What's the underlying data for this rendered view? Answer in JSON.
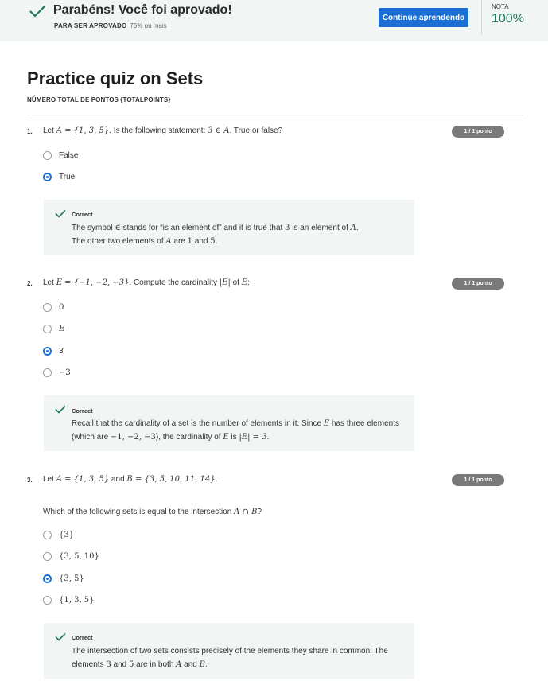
{
  "banner": {
    "congrats": "Parabéns! Você foi aprovado!",
    "pass_label": "PARA SER APROVADO",
    "pass_value": "75% ou mais",
    "continue_label": "Continue aprendendo",
    "grade_label": "NOTA",
    "grade_value": "100%",
    "accent_color": "#1f7a55",
    "button_color": "#1a6fd6"
  },
  "quiz": {
    "title": "Practice quiz on Sets",
    "subtitle": "NÚMERO TOTAL DE PONTOS {TOTALPOINTS}",
    "questions": [
      {
        "number": "1.",
        "score": "1 / 1 ponto",
        "options": [
          "False",
          "True"
        ],
        "selected": "True",
        "feedback_title": "Correct"
      },
      {
        "number": "2.",
        "score": "1 / 1 ponto",
        "options": [
          "0",
          "E",
          "3",
          "−3"
        ],
        "selected": "3",
        "feedback_title": "Correct"
      },
      {
        "number": "3.",
        "score": "1 / 1 ponto",
        "options": [
          "{3}",
          "{3, 5, 10}",
          "{3, 5}",
          "{1, 3, 5}"
        ],
        "selected": "{3, 5}",
        "feedback_title": "Correct"
      }
    ]
  },
  "text": {
    "q1": {
      "let": "Let ",
      "set_a": "A = {1, 3, 5}",
      "ask": ". Is the following statement: ",
      "stmt": "3 ∈ A",
      "tail": ". True or false?",
      "fb_l1a": "The symbol ",
      "fb_in": "∈",
      "fb_l1b": " stands for “is an element of” and it is true that ",
      "fb_3": "3",
      "fb_l1c": " is an element of ",
      "fb_A": "A",
      "fb_l1d": ".",
      "fb_l2a": "The other two elements of ",
      "fb_A2": "A",
      "fb_l2b": " are ",
      "fb_1": "1",
      "fb_l2c": " and ",
      "fb_5": "5",
      "fb_l2d": "."
    },
    "q2": {
      "let": "Let ",
      "set_e": "E = {−1, −2, −3}",
      "ask": ". Compute the cardinality ",
      "card": "|E|",
      "of": " of ",
      "e": "E",
      "tail": ":",
      "fb_a": "Recall that the cardinality of a set is the number of elements in it. Since ",
      "fb_E": "E",
      "fb_b": " has three elements (which are ",
      "fb_vals": "−1, −2, −3",
      "fb_c": "), the cardinality of ",
      "fb_E2": "E",
      "fb_d": " is ",
      "fb_res": "|E| = 3",
      "fb_e": "."
    },
    "q3": {
      "let": "Let ",
      "set_a": "A = {1, 3, 5}",
      "and": " and ",
      "set_b": "B = {3, 5, 10, 11, 14}",
      "dot": ".",
      "ask": "Which of the following sets is equal to the intersection ",
      "inter": "A ∩ B",
      "q": "?",
      "fb_a": "The intersection of two sets consists precisely of the elements they share in common. The elements ",
      "fb_3": "3",
      "fb_b": " and ",
      "fb_5": "5",
      "fb_c": " are in both ",
      "fb_A": "A",
      "fb_d": " and ",
      "fb_B": "B",
      "fb_e": "."
    }
  }
}
